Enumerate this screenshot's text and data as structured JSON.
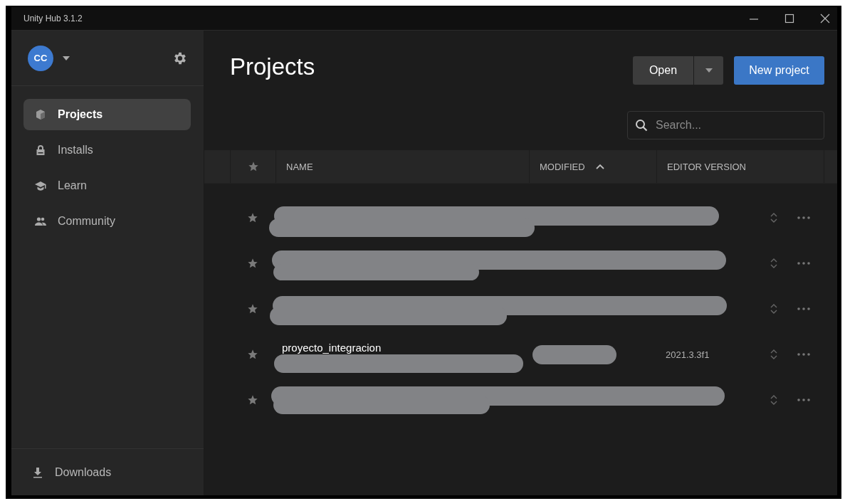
{
  "window": {
    "title": "Unity Hub 3.1.2"
  },
  "sidebar": {
    "avatar": "CC",
    "items": [
      {
        "label": "Projects",
        "selected": true
      },
      {
        "label": "Installs",
        "selected": false
      },
      {
        "label": "Learn",
        "selected": false
      },
      {
        "label": "Community",
        "selected": false
      }
    ],
    "footer": {
      "label": "Downloads"
    }
  },
  "main": {
    "title": "Projects",
    "open_button": "Open",
    "new_button": "New project",
    "search": {
      "placeholder": "Search..."
    },
    "table": {
      "columns": [
        {
          "label": "NAME",
          "sorted": false
        },
        {
          "label": "MODIFIED",
          "sorted": true
        },
        {
          "label": "EDITOR VERSION",
          "sorted": false
        }
      ],
      "rows": [
        {
          "kind": "redacted"
        },
        {
          "kind": "redacted"
        },
        {
          "kind": "redacted"
        },
        {
          "kind": "partial",
          "name": "proyecto_integracion",
          "editor_version": "2021.3.3f1"
        },
        {
          "kind": "redacted"
        }
      ]
    }
  }
}
